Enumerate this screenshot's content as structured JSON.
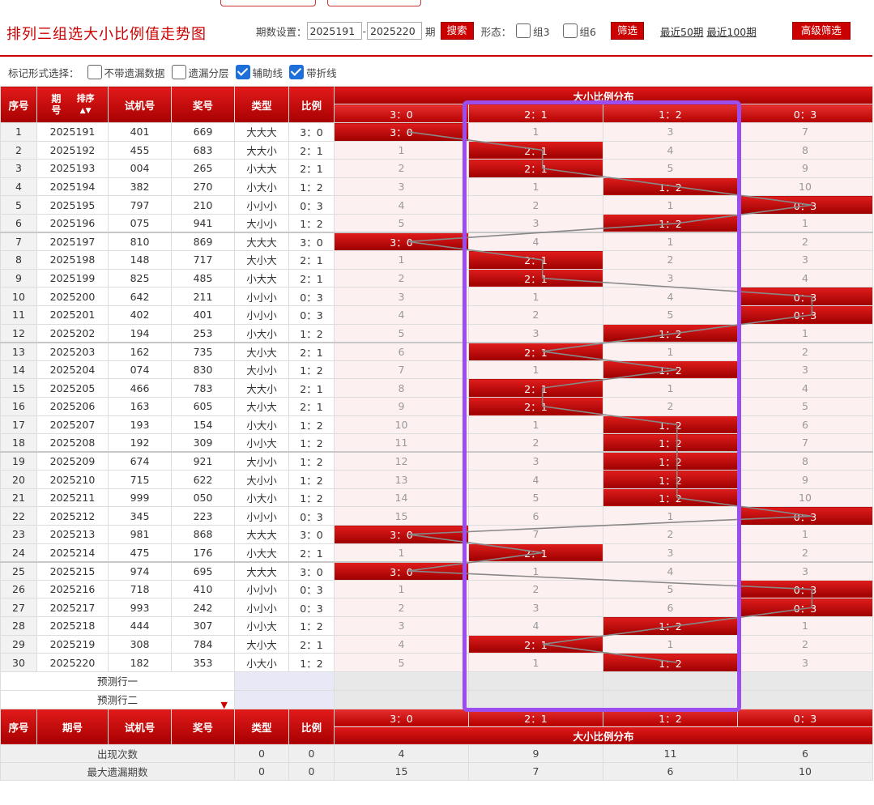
{
  "title": "排列三组选大小比例值走势图",
  "controls": {
    "period_label": "期数设置：",
    "from": "2025191",
    "dash": "-",
    "to": "2025220",
    "qi": "期",
    "search": "搜索",
    "form_label": "形态：",
    "z3": "组3",
    "z6": "组6",
    "filter": "筛选",
    "recent50": "最近50期",
    "recent100": "最近100期",
    "advanced": "高级筛选"
  },
  "mark": {
    "label": "标记形式选择：",
    "opt1": "不带遗漏数据",
    "opt2": "遗漏分层",
    "opt3": "辅助线",
    "opt4": "带折线"
  },
  "headers": {
    "seq": "序号",
    "period": "期号",
    "sort": "排序",
    "trial": "试机号",
    "prize": "奖号",
    "type": "类型",
    "ratio": "比例",
    "dist": "大小比例分布",
    "cols": [
      "3：0",
      "2：1",
      "1：2",
      "0：3"
    ]
  },
  "rows": [
    {
      "seq": "1",
      "period": "2025191",
      "trial": "401",
      "prize": "669",
      "type": "大大大",
      "ratio": "3：0",
      "hit": 0,
      "miss": [
        "3：0",
        "1",
        "3",
        "7"
      ]
    },
    {
      "seq": "2",
      "period": "2025192",
      "trial": "455",
      "prize": "683",
      "type": "大大小",
      "ratio": "2：1",
      "hit": 1,
      "miss": [
        "1",
        "2：1",
        "4",
        "8"
      ]
    },
    {
      "seq": "3",
      "period": "2025193",
      "trial": "004",
      "prize": "265",
      "type": "小大大",
      "ratio": "2：1",
      "hit": 1,
      "miss": [
        "2",
        "2：1",
        "5",
        "9"
      ]
    },
    {
      "seq": "4",
      "period": "2025194",
      "trial": "382",
      "prize": "270",
      "type": "小大小",
      "ratio": "1：2",
      "hit": 2,
      "miss": [
        "3",
        "1",
        "1：2",
        "10"
      ]
    },
    {
      "seq": "5",
      "period": "2025195",
      "trial": "797",
      "prize": "210",
      "type": "小小小",
      "ratio": "0：3",
      "hit": 3,
      "miss": [
        "4",
        "2",
        "1",
        "0：3"
      ]
    },
    {
      "seq": "6",
      "period": "2025196",
      "trial": "075",
      "prize": "941",
      "type": "大小小",
      "ratio": "1：2",
      "hit": 2,
      "miss": [
        "5",
        "3",
        "1：2",
        "1"
      ]
    },
    {
      "seq": "7",
      "period": "2025197",
      "trial": "810",
      "prize": "869",
      "type": "大大大",
      "ratio": "3：0",
      "hit": 0,
      "miss": [
        "3：0",
        "4",
        "1",
        "2"
      ]
    },
    {
      "seq": "8",
      "period": "2025198",
      "trial": "148",
      "prize": "717",
      "type": "大小大",
      "ratio": "2：1",
      "hit": 1,
      "miss": [
        "1",
        "2：1",
        "2",
        "3"
      ]
    },
    {
      "seq": "9",
      "period": "2025199",
      "trial": "825",
      "prize": "485",
      "type": "小大大",
      "ratio": "2：1",
      "hit": 1,
      "miss": [
        "2",
        "2：1",
        "3",
        "4"
      ]
    },
    {
      "seq": "10",
      "period": "2025200",
      "trial": "642",
      "prize": "211",
      "type": "小小小",
      "ratio": "0：3",
      "hit": 3,
      "miss": [
        "3",
        "1",
        "4",
        "0：3"
      ]
    },
    {
      "seq": "11",
      "period": "2025201",
      "trial": "402",
      "prize": "401",
      "type": "小小小",
      "ratio": "0：3",
      "hit": 3,
      "miss": [
        "4",
        "2",
        "5",
        "0：3"
      ]
    },
    {
      "seq": "12",
      "period": "2025202",
      "trial": "194",
      "prize": "253",
      "type": "小大小",
      "ratio": "1：2",
      "hit": 2,
      "miss": [
        "5",
        "3",
        "1：2",
        "1"
      ]
    },
    {
      "seq": "13",
      "period": "2025203",
      "trial": "162",
      "prize": "735",
      "type": "大小大",
      "ratio": "2：1",
      "hit": 1,
      "miss": [
        "6",
        "2：1",
        "1",
        "2"
      ]
    },
    {
      "seq": "14",
      "period": "2025204",
      "trial": "074",
      "prize": "830",
      "type": "大小小",
      "ratio": "1：2",
      "hit": 2,
      "miss": [
        "7",
        "1",
        "1：2",
        "3"
      ]
    },
    {
      "seq": "15",
      "period": "2025205",
      "trial": "466",
      "prize": "783",
      "type": "大大小",
      "ratio": "2：1",
      "hit": 1,
      "miss": [
        "8",
        "2：1",
        "1",
        "4"
      ]
    },
    {
      "seq": "16",
      "period": "2025206",
      "trial": "163",
      "prize": "605",
      "type": "大小大",
      "ratio": "2：1",
      "hit": 1,
      "miss": [
        "9",
        "2：1",
        "2",
        "5"
      ]
    },
    {
      "seq": "17",
      "period": "2025207",
      "trial": "193",
      "prize": "154",
      "type": "小大小",
      "ratio": "1：2",
      "hit": 2,
      "miss": [
        "10",
        "1",
        "1：2",
        "6"
      ]
    },
    {
      "seq": "18",
      "period": "2025208",
      "trial": "192",
      "prize": "309",
      "type": "小小大",
      "ratio": "1：2",
      "hit": 2,
      "miss": [
        "11",
        "2",
        "1：2",
        "7"
      ]
    },
    {
      "seq": "19",
      "period": "2025209",
      "trial": "674",
      "prize": "921",
      "type": "大小小",
      "ratio": "1：2",
      "hit": 2,
      "miss": [
        "12",
        "3",
        "1：2",
        "8"
      ]
    },
    {
      "seq": "20",
      "period": "2025210",
      "trial": "715",
      "prize": "622",
      "type": "大小小",
      "ratio": "1：2",
      "hit": 2,
      "miss": [
        "13",
        "4",
        "1：2",
        "9"
      ]
    },
    {
      "seq": "21",
      "period": "2025211",
      "trial": "999",
      "prize": "050",
      "type": "小大小",
      "ratio": "1：2",
      "hit": 2,
      "miss": [
        "14",
        "5",
        "1：2",
        "10"
      ]
    },
    {
      "seq": "22",
      "period": "2025212",
      "trial": "345",
      "prize": "223",
      "type": "小小小",
      "ratio": "0：3",
      "hit": 3,
      "miss": [
        "15",
        "6",
        "1",
        "0：3"
      ]
    },
    {
      "seq": "23",
      "period": "2025213",
      "trial": "981",
      "prize": "868",
      "type": "大大大",
      "ratio": "3：0",
      "hit": 0,
      "miss": [
        "3：0",
        "7",
        "2",
        "1"
      ]
    },
    {
      "seq": "24",
      "period": "2025214",
      "trial": "475",
      "prize": "176",
      "type": "小大大",
      "ratio": "2：1",
      "hit": 1,
      "miss": [
        "1",
        "2：1",
        "3",
        "2"
      ]
    },
    {
      "seq": "25",
      "period": "2025215",
      "trial": "974",
      "prize": "695",
      "type": "大大大",
      "ratio": "3：0",
      "hit": 0,
      "miss": [
        "3：0",
        "1",
        "4",
        "3"
      ]
    },
    {
      "seq": "26",
      "period": "2025216",
      "trial": "718",
      "prize": "410",
      "type": "小小小",
      "ratio": "0：3",
      "hit": 3,
      "miss": [
        "1",
        "2",
        "5",
        "0：3"
      ]
    },
    {
      "seq": "27",
      "period": "2025217",
      "trial": "993",
      "prize": "242",
      "type": "小小小",
      "ratio": "0：3",
      "hit": 3,
      "miss": [
        "2",
        "3",
        "6",
        "0：3"
      ]
    },
    {
      "seq": "28",
      "period": "2025218",
      "trial": "444",
      "prize": "307",
      "type": "小小大",
      "ratio": "1：2",
      "hit": 2,
      "miss": [
        "3",
        "4",
        "1：2",
        "1"
      ]
    },
    {
      "seq": "29",
      "period": "2025219",
      "trial": "308",
      "prize": "784",
      "type": "大小大",
      "ratio": "2：1",
      "hit": 1,
      "miss": [
        "4",
        "2：1",
        "1",
        "2"
      ]
    },
    {
      "seq": "30",
      "period": "2025220",
      "trial": "182",
      "prize": "353",
      "type": "小大小",
      "ratio": "1：2",
      "hit": 2,
      "miss": [
        "5",
        "1",
        "1：2",
        "3"
      ]
    }
  ],
  "predict": {
    "row1": "预测行一",
    "row2": "预测行二"
  },
  "stats": {
    "occ_label": "出现次数",
    "occ": [
      "0",
      "0",
      "4",
      "9",
      "11",
      "6"
    ],
    "maxmiss_label": "最大遗漏期数",
    "maxmiss": [
      "0",
      "0",
      "15",
      "7",
      "6",
      "10"
    ]
  },
  "colors": {
    "red": "#c00000",
    "highlight": "#9b4dee",
    "line": "#888888"
  }
}
